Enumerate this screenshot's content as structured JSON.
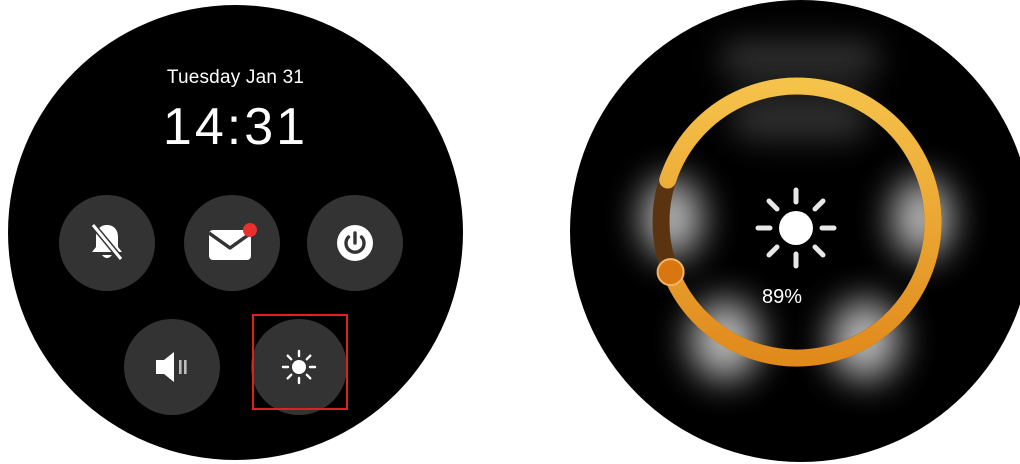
{
  "left_screen": {
    "date": "Tuesday Jan 31",
    "time": "14:31",
    "buttons": [
      {
        "id": "dnd",
        "icon": "bell-off-icon"
      },
      {
        "id": "mail",
        "icon": "mail-icon",
        "badge_color": "#e8302c"
      },
      {
        "id": "power",
        "icon": "power-icon"
      },
      {
        "id": "sound",
        "icon": "speaker-icon"
      },
      {
        "id": "brightness",
        "icon": "sun-icon",
        "highlighted": true
      }
    ],
    "highlight_color": "#e02020"
  },
  "right_screen": {
    "brightness_percent_label": "89%",
    "brightness_level": 0.89,
    "ring_color_bright": "#f3bb3c",
    "ring_color_dark": "#e0871c",
    "ring_track_color": "#5a3410",
    "knob_color": "#d9760f"
  }
}
